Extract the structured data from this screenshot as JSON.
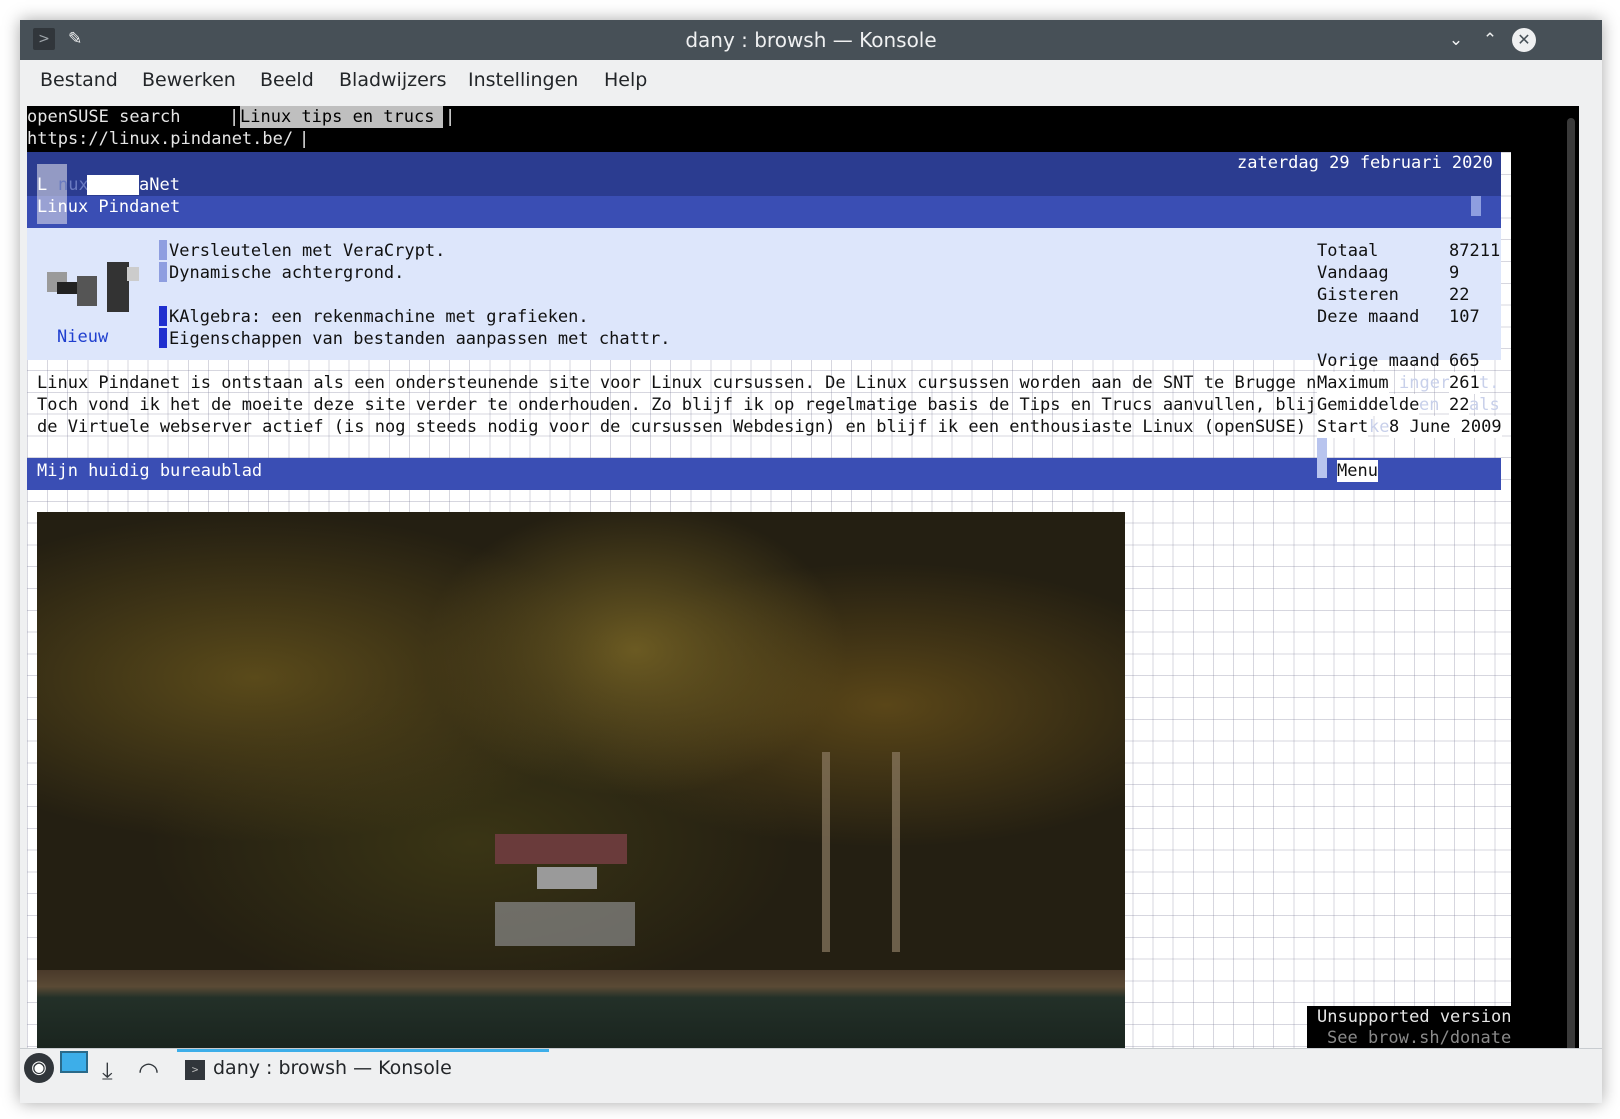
{
  "window": {
    "title": "dany : browsh — Konsole",
    "app_icon": "terminal-icon",
    "pin_icon": "pin-icon"
  },
  "menubar": [
    "Bestand",
    "Bewerken",
    "Beeld",
    "Bladwijzers",
    "Instellingen",
    "Help"
  ],
  "browser": {
    "tabs": [
      "openSUSE search",
      "Linux tips en trucs"
    ],
    "url": "https://linux.pindanet.be/"
  },
  "site": {
    "date": "zaterdag 29 februari 2020",
    "logo_text_l": "L",
    "logo_text_mid": "nux",
    "logo_text_net": "aNet",
    "site_title": "Linux Pindanet",
    "news_label": "Nieuw",
    "news": [
      "Versleutelen met VeraCrypt.",
      "Dynamische achtergrond.",
      "KAlgebra: een rekenmachine met grafieken.",
      "Eigenschappen van bestanden aanpassen met chattr."
    ],
    "intro": [
      "Linux Pindanet is ontstaan als een ondersteunende site voor Linux cursussen. De Linux cursussen worden aan de SNT te Brugge ni",
      "Toch vond ik het de moeite deze site verder te onderhouden. Zo blijf ik op regelmatige basis de Tips en Trucs aanvullen, blijv",
      "de Virtuele webserver actief (is nog steeds nodig voor de cursussen Webdesign) en blijf ik een enthousiaste Linux (openSUSE) g"
    ],
    "stats": [
      {
        "label": "Totaal",
        "value": "87211"
      },
      {
        "label": "Vandaag",
        "value": "9"
      },
      {
        "label": "Gisteren",
        "value": "22"
      },
      {
        "label": "Deze maand",
        "value": "107"
      },
      {
        "label": "Vorige maand",
        "value": "665"
      },
      {
        "label": "Maximum",
        "value": "261"
      },
      {
        "label": "Gemiddelde",
        "value": "22"
      },
      {
        "label": "Start",
        "value": "8 June 2009"
      }
    ],
    "faded_words": [
      "inger",
      "t.",
      "en",
      "als",
      "ke"
    ],
    "desktop_heading": "Mijn huidig bureaublad",
    "menu_label": "Menu",
    "unsupported_line1": "Unsupported version",
    "unsupported_line2": "See brow.sh/donate"
  },
  "taskbar": {
    "launcher_icon": "opensuse-launcher-icon",
    "task_label": "dany : browsh — Konsole",
    "tray_icons": [
      "desktop-icon",
      "download-icon",
      "wifi-icon"
    ]
  },
  "colors": {
    "titlebar": "#475057",
    "header_dark": "#2b3c90",
    "header_mid": "#3a4eb4",
    "news_bg": "#dde6fb",
    "link_blue": "#1f3fcf"
  }
}
